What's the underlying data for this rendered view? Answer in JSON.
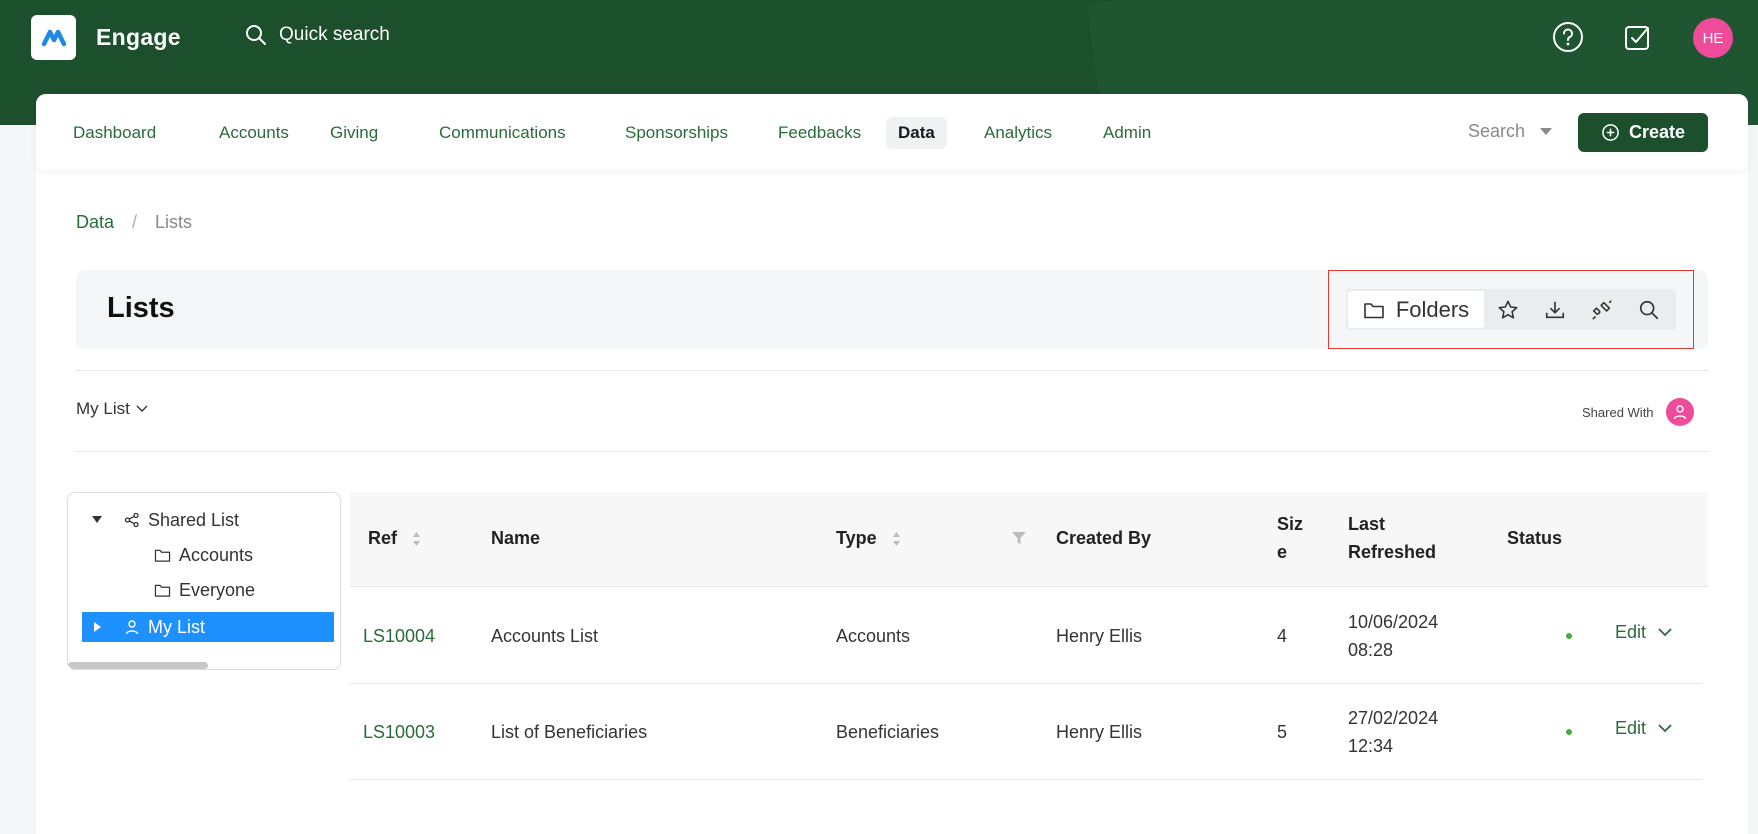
{
  "app": {
    "name": "Engage",
    "quick_search": "Quick search",
    "avatar_initials": "HE"
  },
  "nav": {
    "items": [
      "Dashboard",
      "Accounts",
      "Giving",
      "Communications",
      "Sponsorships",
      "Feedbacks",
      "Data",
      "Analytics",
      "Admin"
    ],
    "active": "Data",
    "search_label": "Search",
    "create_label": "Create"
  },
  "breadcrumb": {
    "parent": "Data",
    "separator": "/",
    "current": "Lists"
  },
  "page": {
    "title": "Lists"
  },
  "toolbar": {
    "folders_label": "Folders"
  },
  "filter": {
    "my_list_label": "My List",
    "shared_with_label": "Shared With"
  },
  "tree": {
    "shared_list": "Shared List",
    "children": [
      "Accounts",
      "Everyone"
    ],
    "my_list": "My List"
  },
  "table": {
    "columns": {
      "ref": "Ref",
      "name": "Name",
      "type": "Type",
      "created_by": "Created By",
      "size_line1": "Siz",
      "size_line2": "e",
      "last_refreshed_line1": "Last",
      "last_refreshed_line2": "Refreshed",
      "status": "Status"
    },
    "rows": [
      {
        "ref": "LS10004",
        "name": "Accounts List",
        "type": "Accounts",
        "created_by": "Henry Ellis",
        "size": "4",
        "date": "10/06/2024",
        "time": "08:28",
        "action": "Edit"
      },
      {
        "ref": "LS10003",
        "name": "List of Beneficiaries",
        "type": "Beneficiaries",
        "created_by": "Henry Ellis",
        "size": "5",
        "date": "27/02/2024",
        "time": "12:34",
        "action": "Edit"
      }
    ]
  },
  "colors": {
    "brand_green": "#1c4f2b",
    "link_green": "#2a6b3a",
    "avatar_pink": "#ef4b9b",
    "selected_blue": "#1e90ff",
    "status_green": "#3bb03b",
    "highlight_red": "#e53935"
  }
}
